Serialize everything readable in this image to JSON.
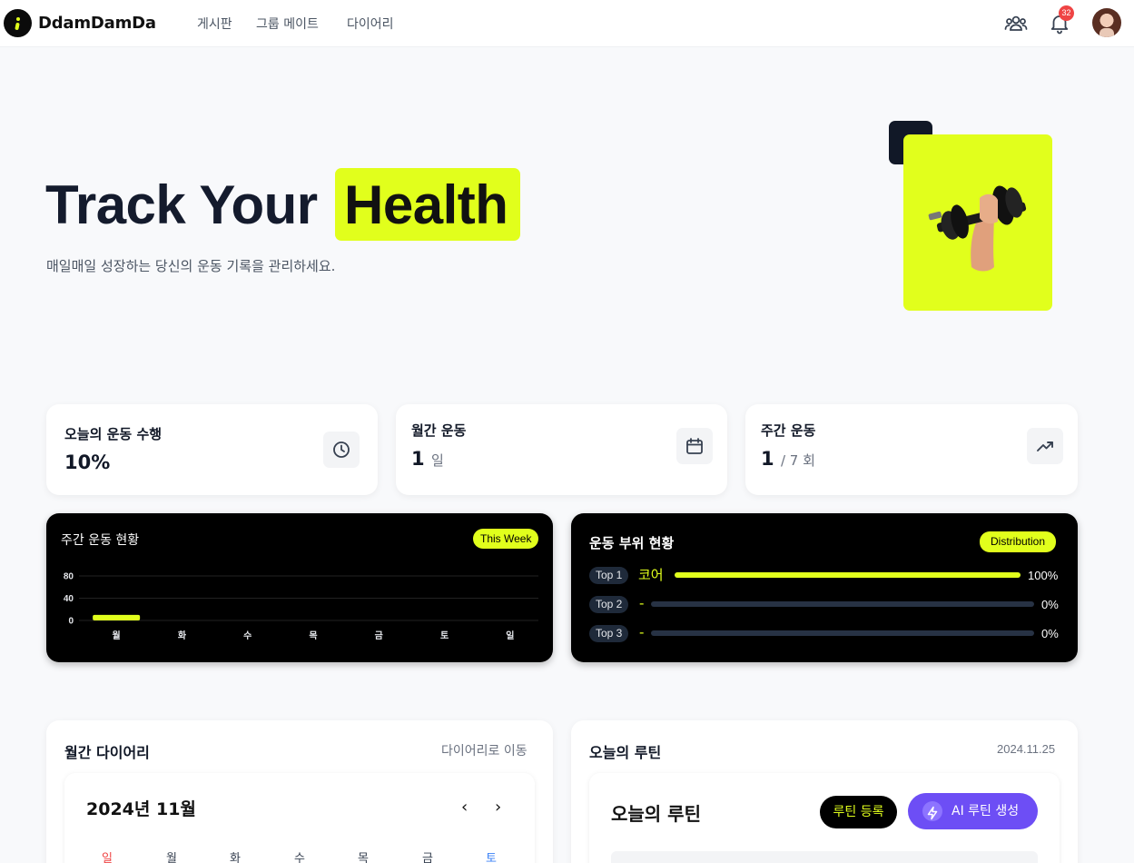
{
  "nav": {
    "brand": "DdamDamDa",
    "links": [
      "게시판",
      "그룹 메이트",
      "다이어리"
    ],
    "notification_count": "32"
  },
  "hero": {
    "title_part1": "Track Your",
    "title_highlight": "Health",
    "subtitle": "매일매일 성장하는 당신의 운동 기록을 관리하세요."
  },
  "stats": {
    "today": {
      "label": "오늘의 운동 수행",
      "value": "10%"
    },
    "monthly": {
      "label": "월간 운동",
      "value": "1",
      "unit": "일"
    },
    "weekly": {
      "label": "주간 운동",
      "value": "1",
      "unit": "/ 7 회"
    }
  },
  "weekly_chart": {
    "title": "주간 운동 현황",
    "badge": "This Week"
  },
  "chart_data": {
    "type": "bar",
    "categories": [
      "월",
      "화",
      "수",
      "목",
      "금",
      "토",
      "일"
    ],
    "values": [
      10,
      0,
      0,
      0,
      0,
      0,
      0
    ],
    "yticks": [
      "80",
      "40",
      "0"
    ],
    "ylim": [
      0,
      100
    ],
    "bar_color": "#e1ff1c"
  },
  "distribution": {
    "title": "운동 부위 현황",
    "badge": "Distribution",
    "rows": [
      {
        "tag": "Top 1",
        "name": "코어",
        "value": 1.0,
        "pct": "100%"
      },
      {
        "tag": "Top 2",
        "name": "-",
        "value": 0.0,
        "pct": "0%"
      },
      {
        "tag": "Top 3",
        "name": "-",
        "value": 0.0,
        "pct": "0%"
      }
    ]
  },
  "diary": {
    "title": "월간 다이어리",
    "link": "다이어리로 이동",
    "month": "2024년 11월",
    "prev": "‹",
    "next": "›",
    "weekdays": [
      "일",
      "월",
      "화",
      "수",
      "목",
      "금",
      "토"
    ]
  },
  "routine": {
    "title": "오늘의 루틴",
    "date": "2024.11.25",
    "inner_title": "오늘의 루틴",
    "register_label": "루틴 등록",
    "ai_label": "AI 루틴 생성"
  },
  "colors": {
    "accent": "#e1ff1c",
    "purple": "#6d4ef5",
    "sunday": "#ef4444",
    "saturday": "#3b82f6"
  }
}
